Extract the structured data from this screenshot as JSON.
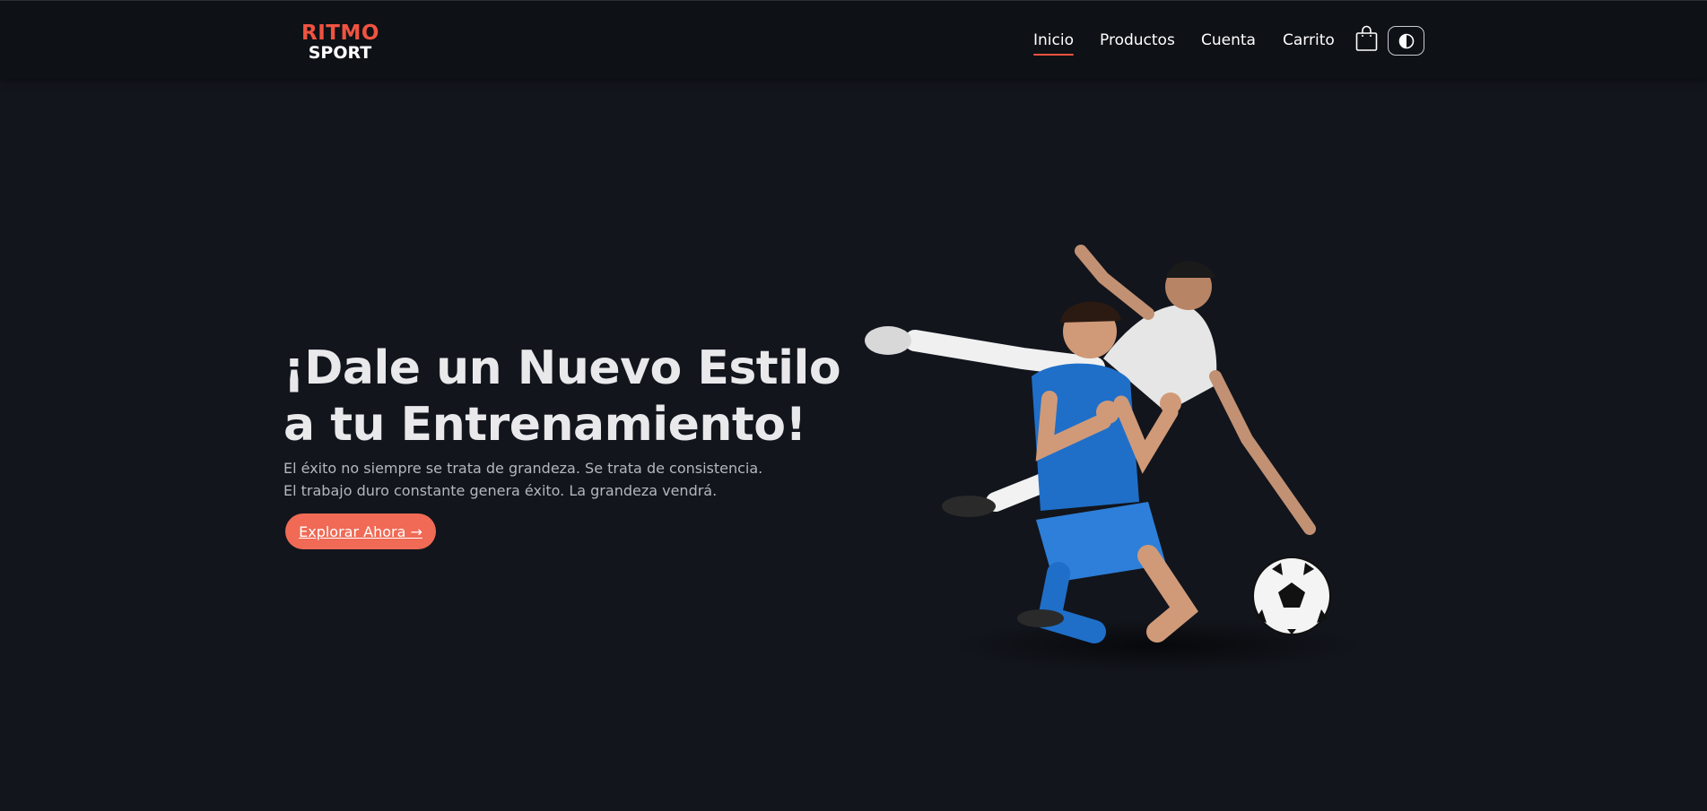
{
  "brand": {
    "line1": "RITMO",
    "line2": "SPORT",
    "accent_color": "#ef5340"
  },
  "nav": {
    "items": [
      {
        "label": "Inicio",
        "active": true
      },
      {
        "label": "Productos",
        "active": false
      },
      {
        "label": "Cuenta",
        "active": false
      },
      {
        "label": "Carrito",
        "active": false
      }
    ],
    "cart_icon": "shopping-bag-icon",
    "theme_icon": "contrast-icon"
  },
  "hero": {
    "title_line1": "¡Dale un Nuevo Estilo",
    "title_line2": "a tu Entrenamiento!",
    "subtitle_line1": "El éxito no siempre se trata de grandeza. Se trata de consistencia.",
    "subtitle_line2": "El trabajo duro constante genera éxito. La grandeza vendrá.",
    "cta_label": "Explorar Ahora →",
    "cta_color": "#f06a55"
  },
  "colors": {
    "background": "#12151c",
    "navbar": "#0e1116"
  }
}
